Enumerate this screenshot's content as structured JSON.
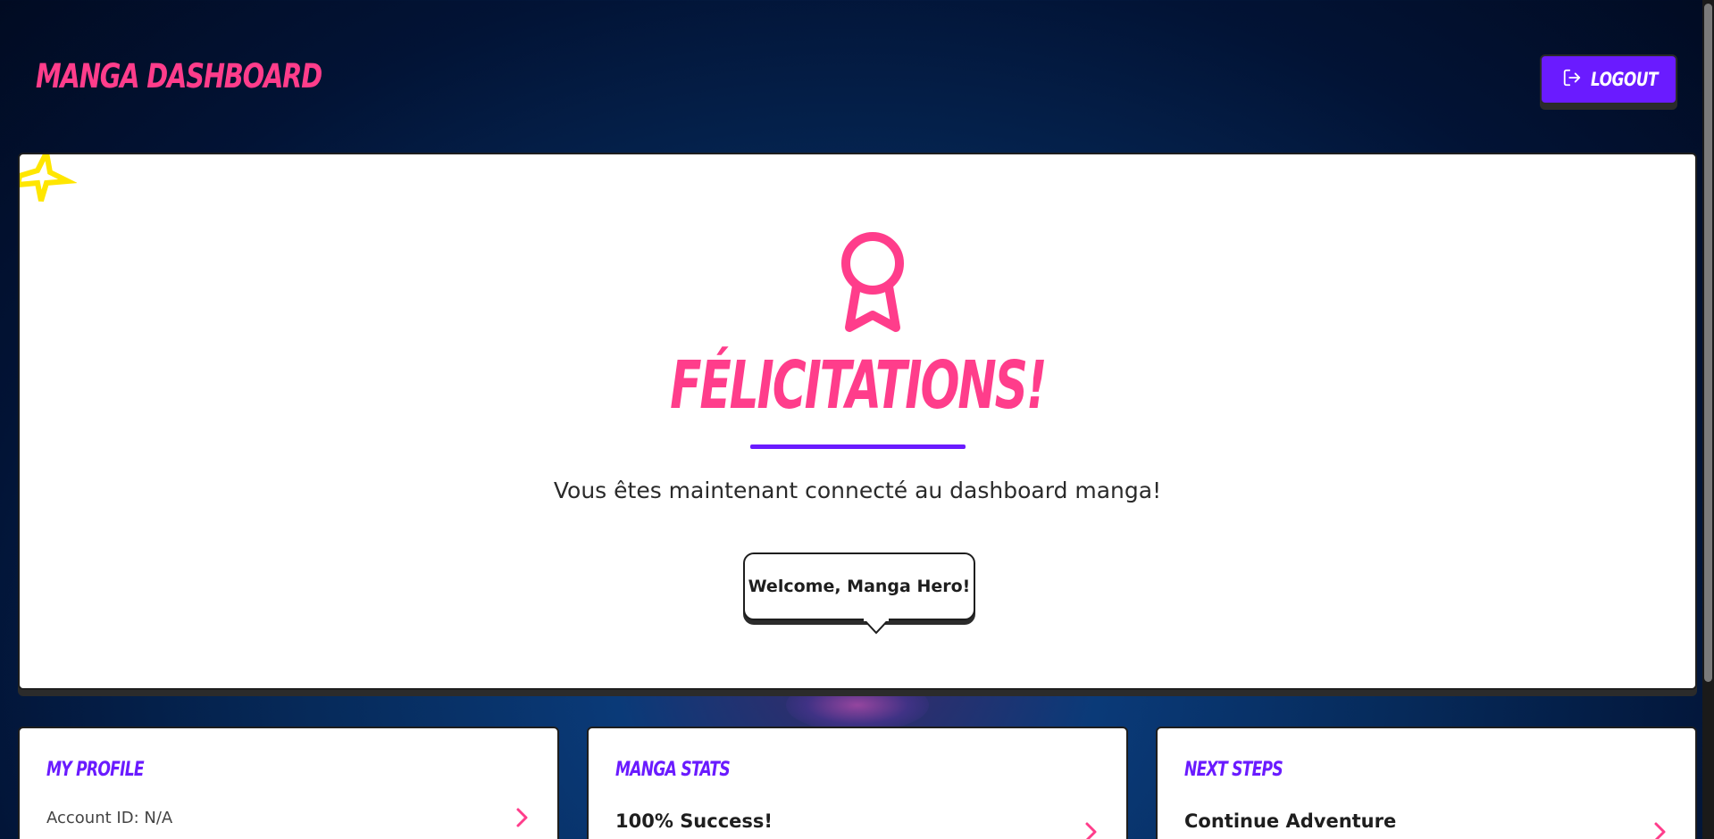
{
  "header": {
    "brand": "Manga Dashboard",
    "logout_label": "Logout"
  },
  "hero": {
    "title": "Félicitations!",
    "subtitle": "Vous êtes maintenant connecté au dashboard manga!",
    "bubble_text": "Welcome, Manga Hero!"
  },
  "cards": [
    {
      "title": "My Profile",
      "body": "Account ID: N/A"
    },
    {
      "title": "Manga Stats",
      "body": "100% Success!"
    },
    {
      "title": "Next Steps",
      "body": "Continue Adventure"
    }
  ],
  "icons": {
    "logout": "logout-icon",
    "award": "award-ribbon-icon",
    "star": "star-icon",
    "chevron": "chevron-right-icon"
  },
  "colors": {
    "accent_pink": "#ff3d8b",
    "accent_purple": "#6a1bff",
    "star_yellow": "#ffe600"
  }
}
